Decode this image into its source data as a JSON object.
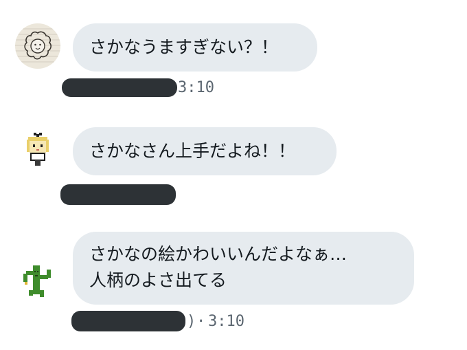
{
  "messages": [
    {
      "avatar_icon": "lion-avatar-icon",
      "lines": [
        "さかなうますぎない？！"
      ],
      "time": "3:10",
      "meta_prefix": ""
    },
    {
      "avatar_icon": "pixel-girl-avatar-icon",
      "lines": [
        "さかなさん上手だよね！！"
      ],
      "time": "",
      "meta_prefix": ""
    },
    {
      "avatar_icon": "pixel-cactus-avatar-icon",
      "lines": [
        "さかなの絵かわいいんだよなぁ…",
        "人柄のよさ出てる"
      ],
      "time": "3:10",
      "meta_prefix": ")"
    }
  ],
  "colors": {
    "bubble": "#e6ebef",
    "redaction": "#2d3236",
    "meta_text": "#5b6670"
  }
}
